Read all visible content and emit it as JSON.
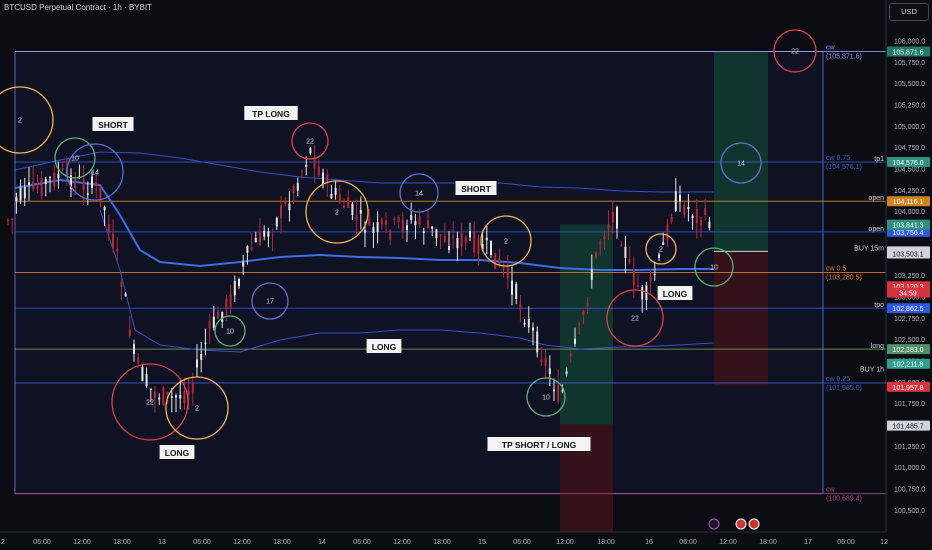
{
  "header": {
    "title": "BTCUSD Perpetual Contract · 1h · BYBIT",
    "currency": "USD"
  },
  "chart_data": {
    "type": "candlestick",
    "symbol": "BTCUSD Perpetual Contract",
    "interval": "1h",
    "exchange": "BYBIT",
    "ylim": [
      100350,
      106300
    ],
    "y_ticks": [
      106000,
      105750,
      105500,
      105250,
      105000,
      104750,
      104500,
      104250,
      104000,
      103750,
      103500,
      103250,
      103000,
      102750,
      102500,
      102250,
      102000,
      101750,
      101500,
      101250,
      101000,
      100750,
      100500
    ],
    "x_ticks": [
      "2",
      "06:00",
      "12:00",
      "18:00",
      "13",
      "06:00",
      "12:00",
      "18:00",
      "14",
      "06:00",
      "12:00",
      "18:00",
      "15",
      "06:00",
      "12:00",
      "18:00",
      "16",
      "06:00",
      "12:00",
      "18:00",
      "17",
      "06:00",
      "12"
    ],
    "levels": [
      {
        "label": "cw",
        "value": 105871.6,
        "value_text": "(105,871.6)",
        "color": "#9598ff",
        "tag": "105,871.6",
        "tag_color": "#1f7a6a"
      },
      {
        "label": "cw 0.75",
        "value": 104576.1,
        "value_text": "(104,576.1)",
        "right_label": "tp1",
        "color": "#3f5bd0",
        "tag": "104,576.0",
        "tag_color": "#2f8f80"
      },
      {
        "label": "",
        "value": 104116.1,
        "right_label": "open",
        "color": "#e08a1e",
        "tag": "104,116.1",
        "tag_color": "#d08320"
      },
      {
        "label": "",
        "value": 103756.4,
        "right_label": "open",
        "color": "#2f58e0",
        "tag": "103,756.4",
        "tag_color": "#2f58e0"
      },
      {
        "label": "cw 0.5",
        "value": 103280.5,
        "value_text": "(103,280.5)",
        "color": "#e07a30",
        "tag": "",
        "tag_color": ""
      },
      {
        "label": "",
        "value": 102862.5,
        "right_label": "tpo",
        "color": "#2f58e0",
        "tag": "102,862.5",
        "tag_color": "#2f58e0"
      },
      {
        "label": "",
        "value": 102383.0,
        "right_label": "long",
        "color": "#7a9a5a",
        "tag": "102,383.0",
        "tag_color": "#4f8f6a"
      },
      {
        "label": "cw 0.25",
        "value": 101985.0,
        "value_text": "(101,985.0)",
        "color": "#3f5bd0",
        "tag": "",
        "tag_color": ""
      },
      {
        "label": "cw",
        "value": 100689.4,
        "value_text": "(100,689.4)",
        "color": "#a44a8a",
        "tag": "",
        "tag_color": ""
      }
    ],
    "price_tags": [
      {
        "text": "103,841.3",
        "value": 103841.3,
        "color": "#2f8f80"
      },
      {
        "text": "103,528.1",
        "value": 103528.1,
        "color": "#d1d4dc"
      },
      {
        "text": "103,503.1",
        "value": 103503.1,
        "color": "#d1d4dc"
      },
      {
        "text": "103,120.3",
        "value": 103120.3,
        "color": "#d6333f"
      },
      {
        "text": "34:59",
        "value": 103045,
        "color": "#d6333f"
      },
      {
        "text": "102,211.8",
        "value": 102211.8,
        "color": "#2fa08a"
      },
      {
        "text": "101,957.8",
        "value": 101940,
        "color": "#d6333f"
      },
      {
        "text": "101,485.7",
        "value": 101485.7,
        "color": "#d1d4dc"
      }
    ],
    "right_labels_extra": [
      {
        "text": "BUY 15m",
        "value": 103540
      },
      {
        "text": "BUY 1h",
        "value": 102120
      }
    ],
    "annotations": [
      {
        "text": "SHORT",
        "x": 113,
        "y": 125
      },
      {
        "text": "TP LONG",
        "x": 271,
        "y": 114
      },
      {
        "text": "SHORT",
        "x": 476,
        "y": 189
      },
      {
        "text": "LONG",
        "x": 384,
        "y": 347
      },
      {
        "text": "LONG",
        "x": 675,
        "y": 294
      },
      {
        "text": "LONG",
        "x": 177,
        "y": 453
      },
      {
        "text": "TP SHORT / LONG",
        "x": 539,
        "y": 445
      }
    ],
    "circles": [
      {
        "label": "2",
        "color": "#f0b45a"
      },
      {
        "label": "10",
        "color": "#5fae7a"
      },
      {
        "label": "14",
        "color": "#5f6fd0"
      },
      {
        "label": "22",
        "color": "#e0404a"
      },
      {
        "label": "2",
        "color": "#f0b45a"
      },
      {
        "label": "14",
        "color": "#5f6fd0"
      },
      {
        "label": "2",
        "color": "#f0b45a"
      },
      {
        "label": "17",
        "color": "#5f6fd0"
      },
      {
        "label": "10",
        "color": "#5fae7a"
      },
      {
        "label": "22",
        "color": "#e0404a"
      },
      {
        "label": "2",
        "color": "#f0b45a"
      },
      {
        "label": "10",
        "color": "#5fae7a"
      },
      {
        "label": "2",
        "color": "#f0b45a"
      },
      {
        "label": "22",
        "color": "#e0404a"
      },
      {
        "label": "14",
        "color": "#5f6fd0"
      },
      {
        "label": "10",
        "color": "#5fae7a"
      },
      {
        "label": "22",
        "color": "#e0404a"
      }
    ]
  }
}
